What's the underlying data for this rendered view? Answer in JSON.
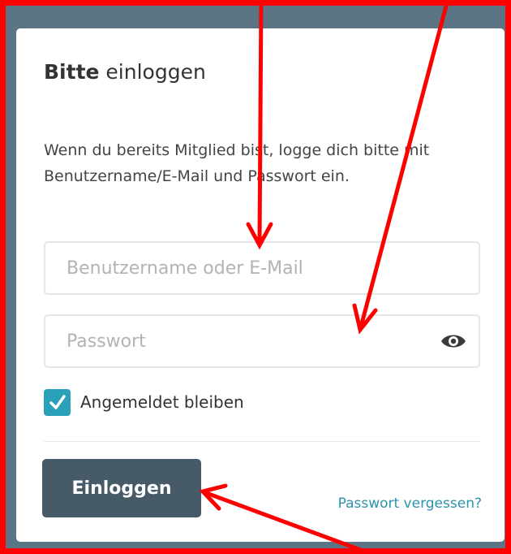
{
  "login": {
    "title_bold": "Bitte",
    "title_rest": " einloggen",
    "description": "Wenn du bereits Mitglied bist, logge dich bitte mit Benutzername/E-Mail und Passwort ein.",
    "username_placeholder": "Benutzername oder E-Mail",
    "password_placeholder": "Passwort",
    "remember_label": "Angemeldet bleiben",
    "remember_checked": true,
    "submit_label": "Einloggen",
    "forgot_label": "Passwort vergessen?",
    "icons": {
      "password_toggle": "eye-icon",
      "checkbox": "checkmark-icon"
    }
  },
  "annotations": {
    "color": "#ff0000",
    "style": "red-arrows"
  },
  "colors": {
    "page_background": "#5b7585",
    "card": "#ffffff",
    "primary_button": "#465a68",
    "checkbox": "#2aa1b8",
    "link": "#2a93ad"
  }
}
